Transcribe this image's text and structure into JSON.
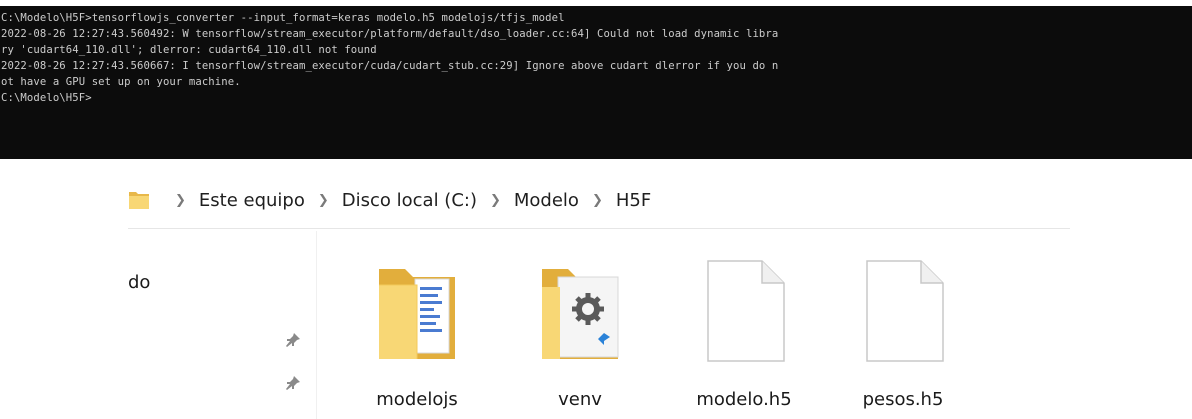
{
  "terminal": {
    "lines": [
      "C:\\Modelo\\H5F>tensorflowjs_converter --input_format=keras modelo.h5 modelojs/tfjs_model",
      "2022-08-26 12:27:43.560492: W tensorflow/stream_executor/platform/default/dso_loader.cc:64] Could not load dynamic libra",
      "ry 'cudart64_110.dll'; dlerror: cudart64_110.dll not found",
      "2022-08-26 12:27:43.560667: I tensorflow/stream_executor/cuda/cudart_stub.cc:29] Ignore above cudart dlerror if you do n",
      "ot have a GPU set up on your machine.",
      "",
      "C:\\Modelo\\H5F>"
    ]
  },
  "explorer": {
    "breadcrumb": [
      "Este equipo",
      "Disco local (C:)",
      "Modelo",
      "H5F"
    ],
    "nav_pane_label": "do",
    "items": [
      {
        "name": "modelojs",
        "type": "folder-icon"
      },
      {
        "name": "venv",
        "type": "folder-settings-icon"
      },
      {
        "name": "modelo.h5",
        "type": "file-icon"
      },
      {
        "name": "pesos.h5",
        "type": "file-icon"
      }
    ]
  },
  "colors": {
    "terminal_bg": "#0c0c0c",
    "terminal_text": "#cccccc",
    "folder": "#f8d775"
  }
}
